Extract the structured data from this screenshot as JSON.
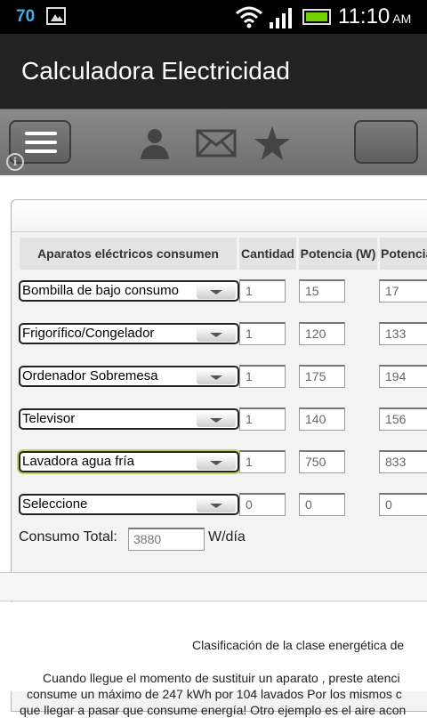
{
  "status_bar": {
    "notification_count": "70",
    "time": "11:10",
    "ampm": "AM"
  },
  "app": {
    "title": "Calculadora Electricidad"
  },
  "toolbar": {
    "icons": [
      "menu-icon",
      "info-icon",
      "person-icon",
      "mail-icon",
      "star-icon"
    ]
  },
  "table": {
    "headers": [
      "Aparatos eléctricos consumen",
      "Cantidad",
      "Potencia (W)",
      "Potencia"
    ],
    "rows": [
      {
        "appliance": "Bombilla de bajo consumo",
        "cantidad": "1",
        "potencia": "15",
        "potencia2": "17"
      },
      {
        "appliance": "Frigorífico/Congelador",
        "cantidad": "1",
        "potencia": "120",
        "potencia2": "133"
      },
      {
        "appliance": "Ordenador Sobremesa",
        "cantidad": "1",
        "potencia": "175",
        "potencia2": "194"
      },
      {
        "appliance": "Televisor",
        "cantidad": "1",
        "potencia": "140",
        "potencia2": "156"
      },
      {
        "appliance": "Lavadora agua fría",
        "cantidad": "1",
        "potencia": "750",
        "potencia2": "833"
      },
      {
        "appliance": "Seleccione",
        "cantidad": "0",
        "potencia": "0",
        "potencia2": "0"
      }
    ]
  },
  "total": {
    "label": "Consumo Total:",
    "value": "3880",
    "unit": "W/día"
  },
  "info": {
    "heading": "Clasificación de la clase energética de",
    "paragraph": [
      "        Cuando llegue el momento de sustituir un aparato , preste atenci",
      "     consume un máximo de 247 kWh por 104 lavados Por los mismos c",
      "  que llegar a pasar que consume energía! Otro ejemplo es el aire acon"
    ]
  },
  "colors": {
    "accent_blue": "#3fb0e8",
    "battery_green": "#6fd100",
    "active_select_glow": "#b8d36a"
  }
}
